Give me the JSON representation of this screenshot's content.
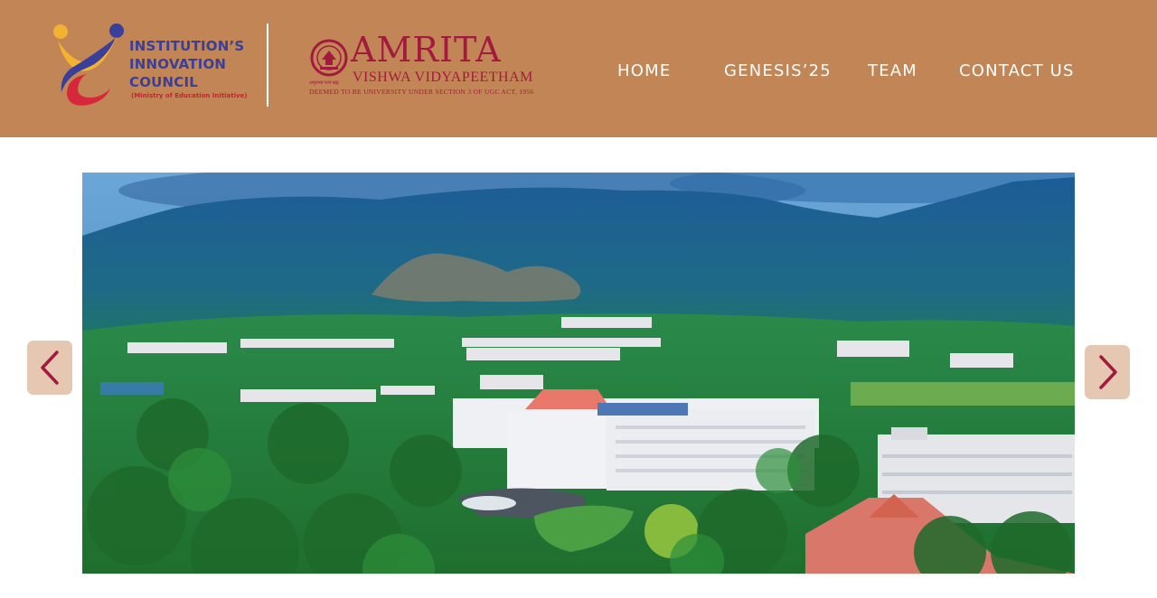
{
  "header": {
    "iic_logo": {
      "lines": [
        "INSTITUTION’S",
        "INNOVATION",
        "COUNCIL"
      ],
      "subtitle": "(Ministry of Education Initiative)"
    },
    "amrita_logo": {
      "name": "AMRITA",
      "tagline": "VISHWA VIDYAPEETHAM",
      "motto_small": "अमृतमयं परमं ब्रह्म",
      "deemed_line": "DEEMED TO BE UNIVERSITY UNDER SECTION 3 OF UGC ACT, 1956"
    },
    "nav": {
      "home": "HOME",
      "genesis": "GENESIS’25",
      "team": "TEAM",
      "contact": "CONTACT US"
    }
  },
  "carousel": {
    "slide_icon": "campus-aerial-photo",
    "prev_icon": "chevron-left-icon",
    "next_icon": "chevron-right-icon"
  },
  "colors": {
    "header_bg": "#c28556",
    "nav_text": "#ffffff",
    "amrita_brand": "#a21b3f",
    "iic_blue": "#3a3f9a",
    "arrow_bg": "#e6c7b1",
    "arrow_chevron": "#a21b3f"
  }
}
